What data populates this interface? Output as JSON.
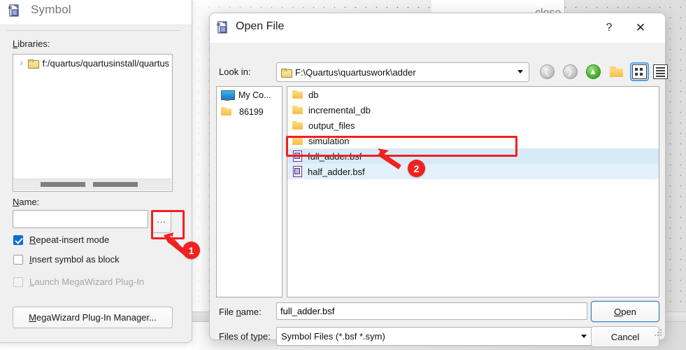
{
  "symbol_window": {
    "title": "Symbol",
    "icon": "symbol-file-icon",
    "close_icon": "close-icon",
    "libraries_label": "Libraries:",
    "library_tree": [
      {
        "expander_icon": "chevron-right-icon",
        "folder_icon": "folder-icon",
        "label": "f:/quartus/quartusinstall/quartus"
      }
    ],
    "name_label": "Name:",
    "name_value": "",
    "browse_button_label": "...",
    "checkboxes": [
      {
        "label": "Repeat-insert mode",
        "checked": true,
        "enabled": true,
        "mnemonic": "R"
      },
      {
        "label": "Insert symbol as block",
        "checked": false,
        "enabled": true,
        "mnemonic": "I"
      },
      {
        "label": "Launch MegaWizard Plug-In",
        "checked": false,
        "enabled": false,
        "mnemonic": "L"
      }
    ],
    "megawizard_button": "MegaWizard Plug-In Manager..."
  },
  "open_dialog": {
    "title": "Open File",
    "icon": "symbol-file-icon",
    "help_icon": "?",
    "close_icon": "✕",
    "look_in_label": "Look in:",
    "look_in_value": "F:\\Quartus\\quartuswork\\adder",
    "look_in_folder_icon": "folder-icon",
    "toolbar": [
      {
        "name": "back-button",
        "icon": "back-arrow-icon",
        "enabled": false
      },
      {
        "name": "forward-button",
        "icon": "forward-arrow-icon",
        "enabled": false
      },
      {
        "name": "parent-directory-button",
        "icon": "up-arrow-icon",
        "enabled": true
      },
      {
        "name": "new-folder-button",
        "icon": "new-folder-icon",
        "enabled": true
      },
      {
        "name": "list-view-button",
        "icon": "list-view-icon",
        "selected": true
      },
      {
        "name": "detail-view-button",
        "icon": "detail-view-icon",
        "selected": false
      }
    ],
    "places": [
      {
        "label": "My Co...",
        "icon": "my-computer-icon"
      },
      {
        "label": "86199",
        "icon": "folder-icon"
      }
    ],
    "files": [
      {
        "name": "db",
        "type": "folder",
        "icon": "folder-icon",
        "selected": false
      },
      {
        "name": "incremental_db",
        "type": "folder",
        "icon": "folder-icon",
        "selected": false
      },
      {
        "name": "output_files",
        "type": "folder",
        "icon": "folder-icon",
        "selected": false
      },
      {
        "name": "simulation",
        "type": "folder",
        "icon": "folder-icon",
        "selected": false
      },
      {
        "name": "full_adder.bsf",
        "type": "file",
        "icon": "bsf-file-icon",
        "selected": true
      },
      {
        "name": "half_adder.bsf",
        "type": "file",
        "icon": "bsf-file-icon",
        "selected": false
      }
    ],
    "file_name_label": "File name:",
    "file_name_value": "full_adder.bsf",
    "files_of_type_label": "Files of type:",
    "files_of_type_value": "Symbol Files (*.bsf *.sym)",
    "open_button": "Open",
    "cancel_button": "Cancel"
  },
  "annotations": [
    {
      "id": "1",
      "target": "browse-button",
      "shape": "rect+arrow"
    },
    {
      "id": "2",
      "target": "full_adder.bsf row",
      "shape": "rect+arrow"
    }
  ],
  "colors": {
    "annotation_red": "#f02121",
    "selection_blue": "#d7eaf7",
    "accent_blue": "#2878c8",
    "checkbox_blue": "#0b6fd4"
  }
}
